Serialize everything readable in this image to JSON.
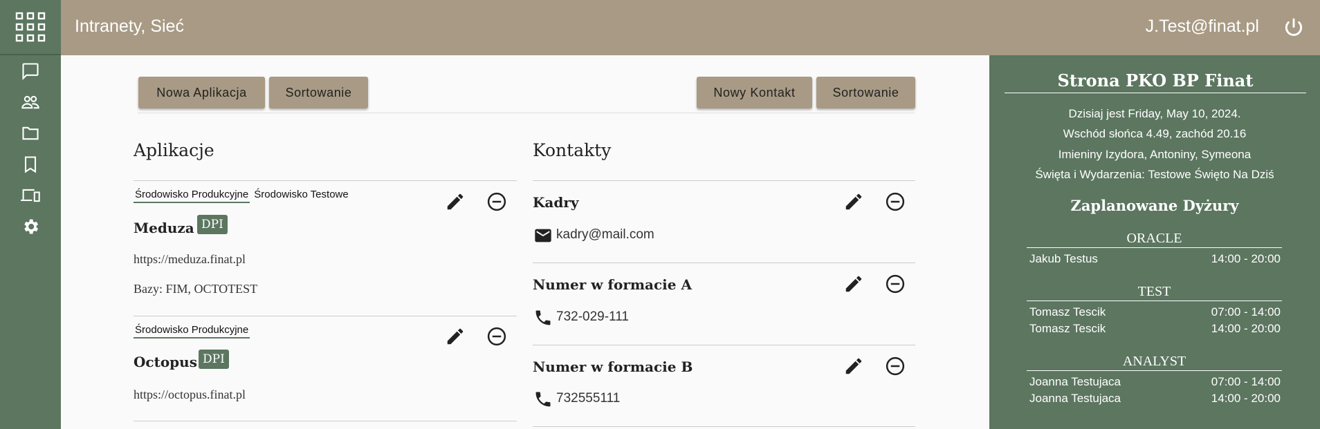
{
  "header": {
    "title": "Intranety, Sieć",
    "user_email": "J.Test@finat.pl"
  },
  "rail": {
    "items": [
      "apps-grid-icon",
      "chat-icon",
      "people-icon",
      "folder-icon",
      "bookmark-icon",
      "devices-icon",
      "gear-icon"
    ]
  },
  "toolbar": {
    "new_app_label": "Nowa Aplikacja",
    "sort_apps_label": "Sortowanie",
    "new_contact_label": "Nowy Kontakt",
    "sort_contacts_label": "Sortowanie"
  },
  "apps": {
    "title": "Aplikacje",
    "items": [
      {
        "envs": [
          "Środowisko Produkcyjne",
          "Środowisko Testowe"
        ],
        "name": "Meduza",
        "badge": "DPI",
        "url": "https://meduza.finat.pl",
        "bazy": "Bazy: FIM, OCTOTEST"
      },
      {
        "envs": [
          "Środowisko Produkcyjne"
        ],
        "name": "Octopus",
        "badge": "DPI",
        "url": "https://octopus.finat.pl"
      }
    ]
  },
  "contacts": {
    "title": "Kontakty",
    "items": [
      {
        "name": "Kadry",
        "value": "kadry@mail.com",
        "icon": "mail-icon"
      },
      {
        "name": "Numer w formacie A",
        "value": "732-029-111",
        "icon": "phone-icon"
      },
      {
        "name": "Numer w formacie B",
        "value": "732555111",
        "icon": "phone-icon"
      }
    ]
  },
  "panel": {
    "title": "Strona PKO BP Finat",
    "date_line": "Dzisiaj jest Friday, May 10, 2024.",
    "sun_line": "Wschód słońca 4.49, zachód 20.16",
    "nameday_line": "Imieniny Izydora, Antoniny, Symeona",
    "holiday_line": "Święta i Wydarzenia: Testowe Święto Na Dziś",
    "duty_title": "Zaplanowane Dyżury",
    "groups": [
      {
        "name": "ORACLE",
        "rows": [
          {
            "person": "Jakub Testus",
            "hours": "14:00 - 20:00"
          }
        ]
      },
      {
        "name": "TEST",
        "rows": [
          {
            "person": "Tomasz Tescik",
            "hours": "07:00 - 14:00"
          },
          {
            "person": "Tomasz Tescik",
            "hours": "14:00 - 20:00"
          }
        ]
      },
      {
        "name": "ANALYST",
        "rows": [
          {
            "person": "Joanna Testujaca",
            "hours": "07:00 - 14:00"
          },
          {
            "person": "Joanna Testujaca",
            "hours": "14:00 - 20:00"
          }
        ]
      }
    ]
  },
  "colors": {
    "sage": "#5c7660",
    "taupe": "#a89a84"
  }
}
